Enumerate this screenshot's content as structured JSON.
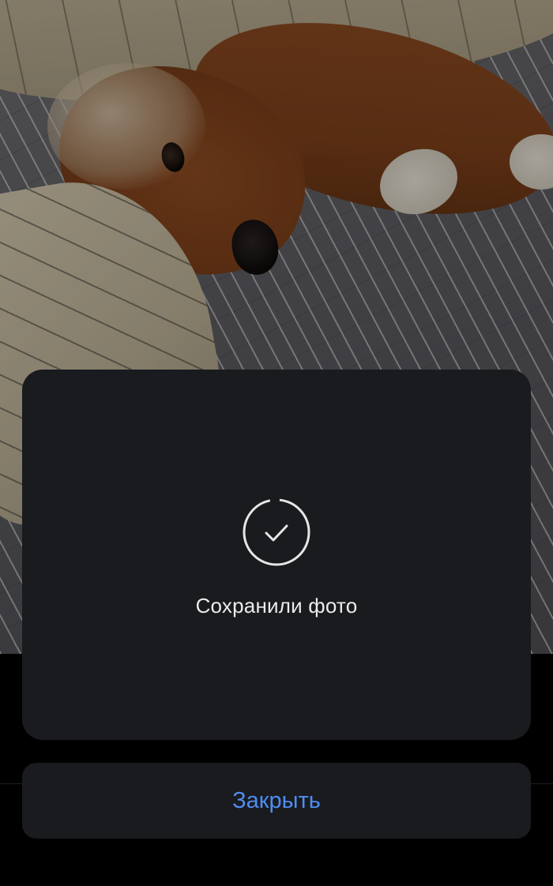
{
  "photo": {
    "icon": "dog-photo"
  },
  "dialog": {
    "icon": "check-circle-icon",
    "message": "Сохранили фото"
  },
  "actions": {
    "close_label": "Закрыть"
  },
  "colors": {
    "accent": "#4f8df1",
    "dialog_bg": "#1a1b1f",
    "text": "#ececec",
    "background": "#000000"
  }
}
